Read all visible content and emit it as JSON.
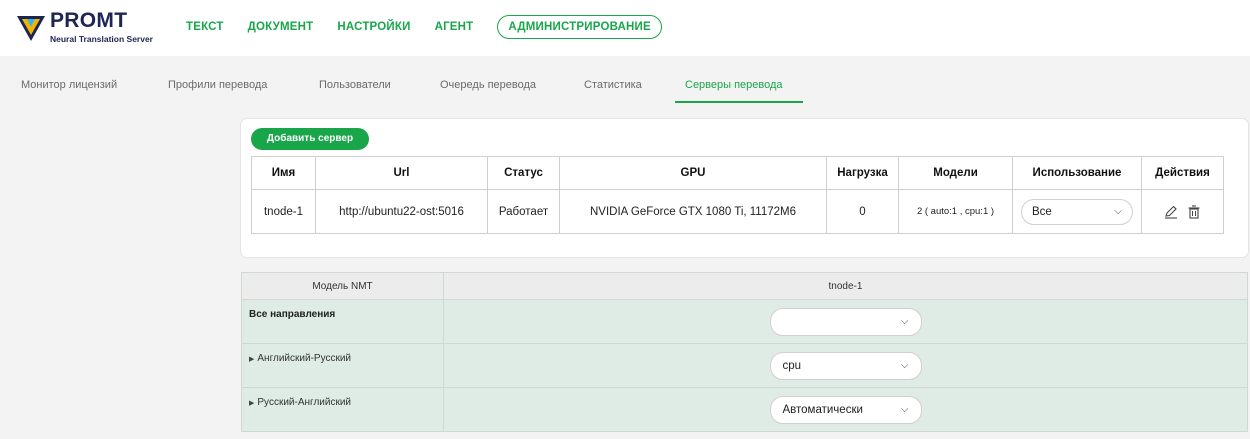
{
  "brand": {
    "name": "PROMT",
    "subtitle": "Neural Translation Server"
  },
  "top_nav": [
    "ТЕКСТ",
    "ДОКУМЕНТ",
    "НАСТРОЙКИ",
    "АГЕНТ",
    "АДМИНИСТРИРОВАНИЕ"
  ],
  "top_nav_active": "АДМИНИСТРИРОВАНИЕ",
  "sub_nav": [
    "Монитор лицензий",
    "Профили перевода",
    "Пользователи",
    "Очередь перевода",
    "Статистика",
    "Серверы перевода"
  ],
  "sub_nav_active": "Серверы перевода",
  "servers_panel": {
    "add_button": "Добавить сервер",
    "columns": [
      "Имя",
      "Url",
      "Статус",
      "GPU",
      "Нагрузка",
      "Модели",
      "Использование",
      "Действия"
    ],
    "rows": [
      {
        "name": "tnode-1",
        "url": "http://ubuntu22-ost:5016",
        "status": "Работает",
        "gpu": "NVIDIA GeForce GTX 1080 Ti, 11172M6",
        "load": "0",
        "models": "2 ( auto:1 , cpu:1 )",
        "usage": "Все"
      }
    ]
  },
  "model_table": {
    "header_model": "Модель NMT",
    "header_node": "tnode-1",
    "rows": [
      {
        "label": "Все направления",
        "value": ""
      },
      {
        "label": "Английский-Русский",
        "value": "cpu"
      },
      {
        "label": "Русский-Английский",
        "value": "Автоматически"
      }
    ]
  },
  "colors": {
    "accent": "#19a64b",
    "brand_dark": "#1d2553",
    "row_bg": "#dfece5"
  },
  "icons": [
    "promt-logo-icon",
    "chevron-down-icon",
    "edit-icon",
    "trash-icon",
    "triangle-right-icon"
  ]
}
